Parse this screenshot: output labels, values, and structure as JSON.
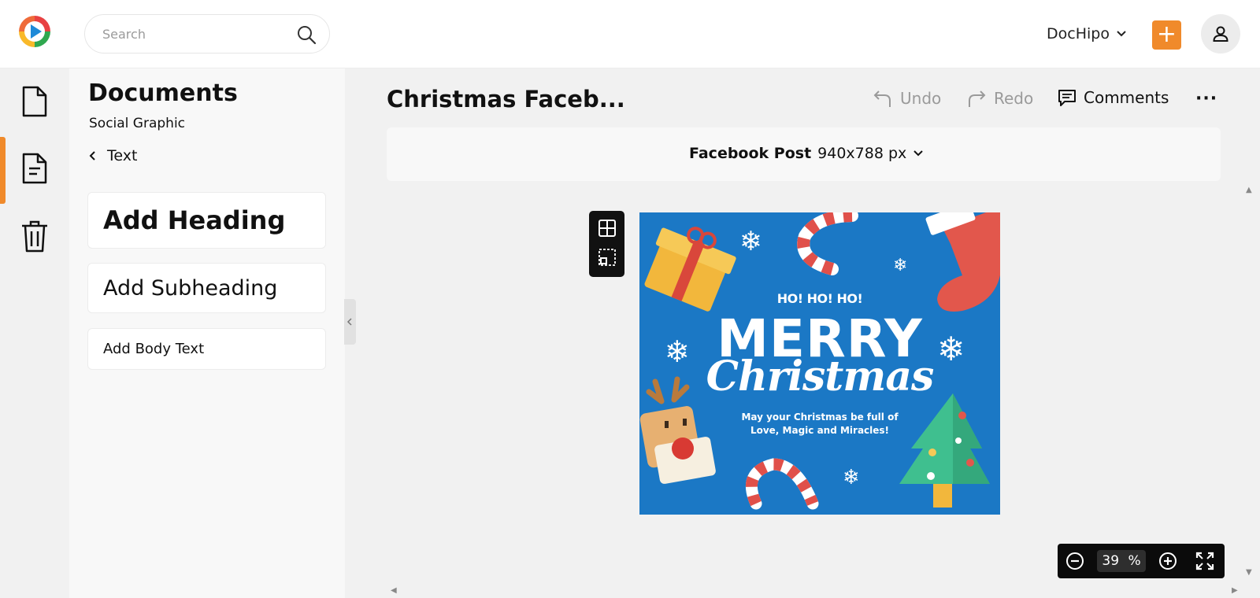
{
  "header": {
    "search_placeholder": "Search",
    "brand": "DocHipo",
    "add_label": "+"
  },
  "panel": {
    "title": "Documents",
    "subtitle": "Social Graphic",
    "back_label": "Text",
    "cards": {
      "heading": "Add Heading",
      "subheading": "Add Subheading",
      "body": "Add Body Text"
    }
  },
  "editor": {
    "doc_title": "Christmas Faceb...",
    "undo": "Undo",
    "redo": "Redo",
    "comments": "Comments",
    "more": "···",
    "size_name": "Facebook Post",
    "size_dims": "940x788 px"
  },
  "artwork": {
    "line1": "HO! HO! HO!",
    "line2": "MERRY",
    "line3": "Christmas",
    "line4": "May your Christmas be full of Love, Magic and Miracles!",
    "background": "#1b78c5"
  },
  "zoom": {
    "value": "39",
    "unit": "%"
  },
  "colors": {
    "accent": "#f08a2b"
  },
  "icons": {
    "rail": [
      "document-icon",
      "text-document-icon",
      "trash-icon"
    ],
    "toolbar": [
      "undo-icon",
      "redo-icon",
      "comment-icon"
    ]
  }
}
